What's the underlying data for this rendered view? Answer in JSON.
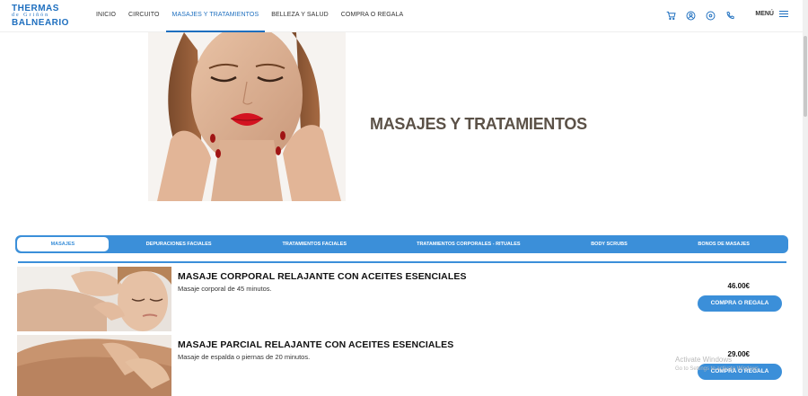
{
  "header": {
    "logo": {
      "line1": "THERMAS",
      "line2": "de Griñón",
      "line3": "BALNEARIO"
    },
    "nav": [
      {
        "label": "INICIO",
        "name": "nav-inicio",
        "active": false
      },
      {
        "label": "CIRCUITO",
        "name": "nav-circuito",
        "active": false
      },
      {
        "label": "MASAJES Y TRATAMIENTOS",
        "name": "nav-masajes-tratamientos",
        "active": true
      },
      {
        "label": "BELLEZA Y SALUD",
        "name": "nav-belleza-salud",
        "active": false
      },
      {
        "label": "COMPRA O REGALA",
        "name": "nav-compra-regala",
        "active": false
      }
    ],
    "icons": [
      "cart-icon",
      "user-icon",
      "location-icon",
      "phone-icon"
    ],
    "menu_label": "MENÚ"
  },
  "hero": {
    "title": "MASAJES Y TRATAMIENTOS"
  },
  "tabs": [
    {
      "label": "MASAJES",
      "name": "tab-masajes",
      "active": true
    },
    {
      "label": "DEPURACIONES FACIALES",
      "name": "tab-depuraciones-faciales",
      "active": false
    },
    {
      "label": "TRATAMIENTOS FACIALES",
      "name": "tab-tratamientos-faciales",
      "active": false
    },
    {
      "label": "TRATAMIENTOS CORPORALES - RITUALES",
      "name": "tab-tratamientos-corporales",
      "active": false
    },
    {
      "label": "BODY SCRUBS",
      "name": "tab-body-scrubs",
      "active": false
    },
    {
      "label": "BONOS DE MASAJES",
      "name": "tab-bonos-masajes",
      "active": false
    }
  ],
  "products": [
    {
      "title": "MASAJE CORPORAL RELAJANTE CON ACEITES ESENCIALES",
      "description": "Masaje corporal de 45 minutos.",
      "price": "46.00€",
      "button": "COMPRA O REGALA"
    },
    {
      "title": "MASAJE PARCIAL RELAJANTE CON ACEITES ESENCIALES",
      "description": "Masaje de espalda o piernas de 20 minutos.",
      "price": "29.00€",
      "button": "COMPRA O REGALA"
    }
  ],
  "watermark": {
    "line1": "Activate Windows",
    "line2": "Go to Settings to activate Windows."
  },
  "colors": {
    "accent": "#3b8fd9",
    "brand": "#1e6fbf",
    "title": "#5b5147"
  }
}
